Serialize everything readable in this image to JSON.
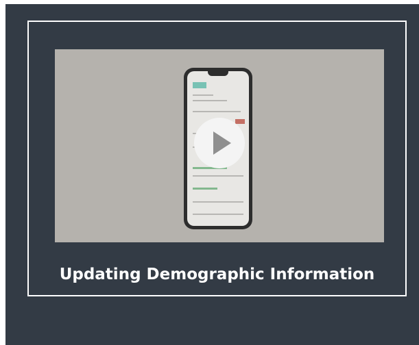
{
  "video": {
    "title": "Updating Demographic Information",
    "play_icon": "play-icon"
  },
  "colors": {
    "panel_background": "#333b45",
    "card_border": "#ffffff",
    "thumbnail_background": "#b5b2ad",
    "title_text": "#ffffff"
  }
}
